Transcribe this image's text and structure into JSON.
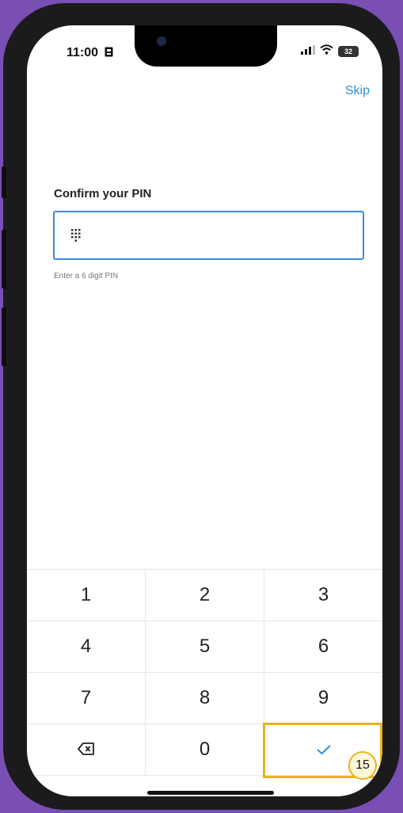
{
  "status_bar": {
    "time": "11:00",
    "battery": "32"
  },
  "header": {
    "skip_label": "Skip"
  },
  "pin": {
    "title": "Confirm your PIN",
    "hint": "Enter a 6 digit PIN",
    "value": ""
  },
  "keypad": {
    "rows": [
      [
        "1",
        "2",
        "3"
      ],
      [
        "4",
        "5",
        "6"
      ],
      [
        "7",
        "8",
        "9"
      ]
    ],
    "zero": "0",
    "backspace_icon": "backspace-icon",
    "confirm_icon": "checkmark-icon"
  },
  "annotation": {
    "step_number": "15",
    "highlight_color": "#e9b21a"
  },
  "colors": {
    "accent": "#2f8fd6",
    "input_border": "#3d8bd4",
    "frame": "#7a4fb4"
  }
}
